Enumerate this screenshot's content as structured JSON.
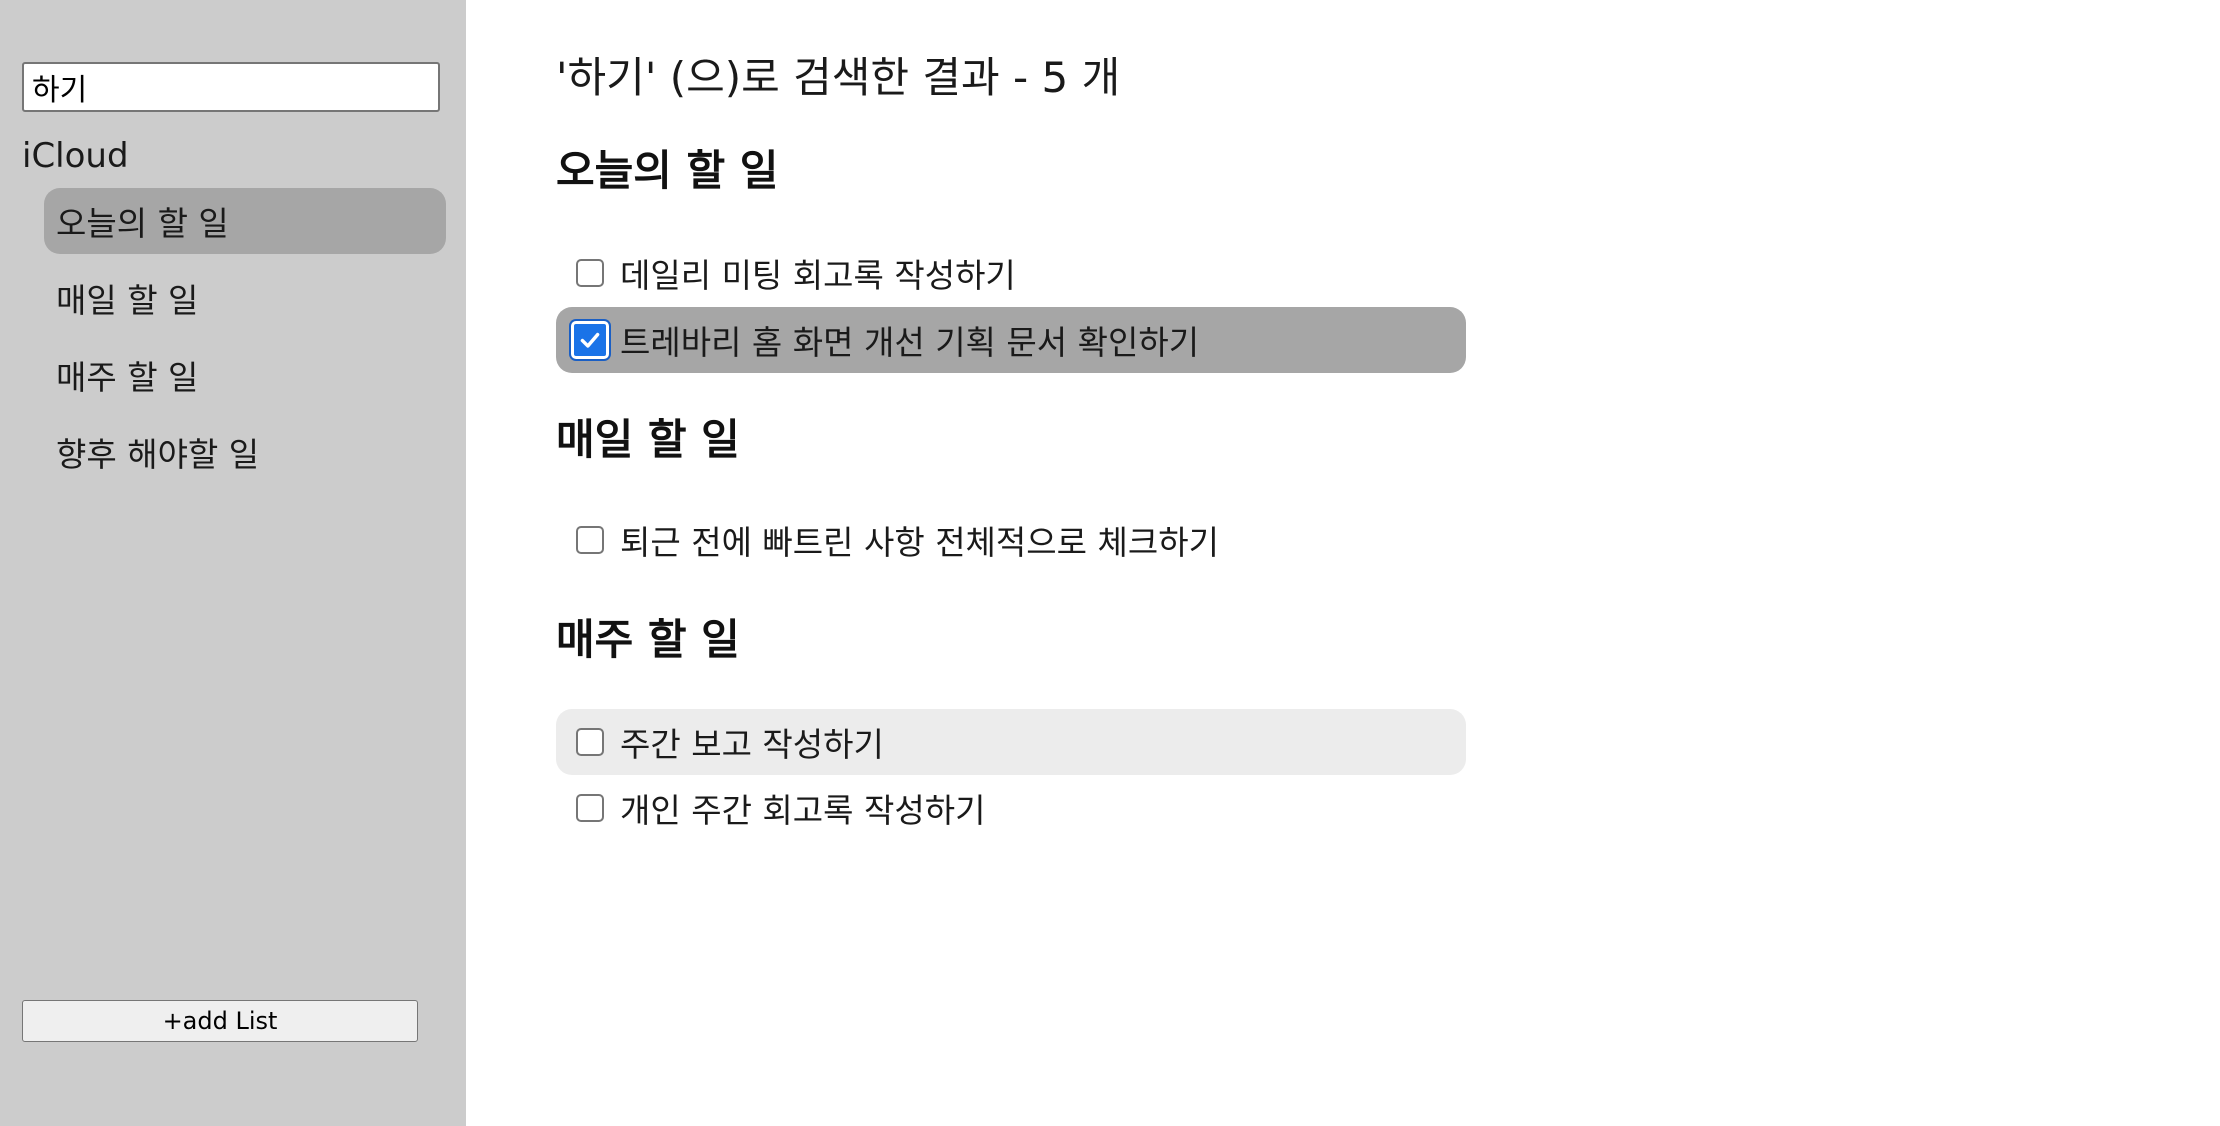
{
  "sidebar": {
    "search": {
      "value": "하기",
      "placeholder": ""
    },
    "account_label": "iCloud",
    "lists": [
      {
        "label": "오늘의 할 일",
        "selected": true
      },
      {
        "label": "매일 할 일",
        "selected": false
      },
      {
        "label": "매주 할 일",
        "selected": false
      },
      {
        "label": "향후 해야할 일",
        "selected": false
      }
    ],
    "add_list_label": "+add List"
  },
  "main": {
    "results_title": "'하기' (으)로 검색한 결과 - 5 개",
    "groups": [
      {
        "heading": "오늘의 할 일",
        "tasks": [
          {
            "label": "데일리 미팅 회고록 작성하기",
            "checked": false
          },
          {
            "label": "트레바리 홈 화면 개선 기획 문서 확인하기",
            "checked": true
          }
        ]
      },
      {
        "heading": "매일 할 일",
        "tasks": [
          {
            "label": "퇴근 전에 빠트린 사항 전체적으로 체크하기",
            "checked": false
          }
        ]
      },
      {
        "heading": "매주 할 일",
        "tasks": [
          {
            "label": "주간 보고 작성하기",
            "checked": false
          },
          {
            "label": "개인 주간 회고록 작성하기",
            "checked": false
          }
        ]
      }
    ]
  },
  "colors": {
    "sidebar_bg": "#cccccc",
    "selected_bg": "#a6a6a6",
    "hover_bg": "#ececec",
    "checkbox_accent": "#1a73e8"
  },
  "icons": {
    "checkmark": "checkmark-icon"
  }
}
